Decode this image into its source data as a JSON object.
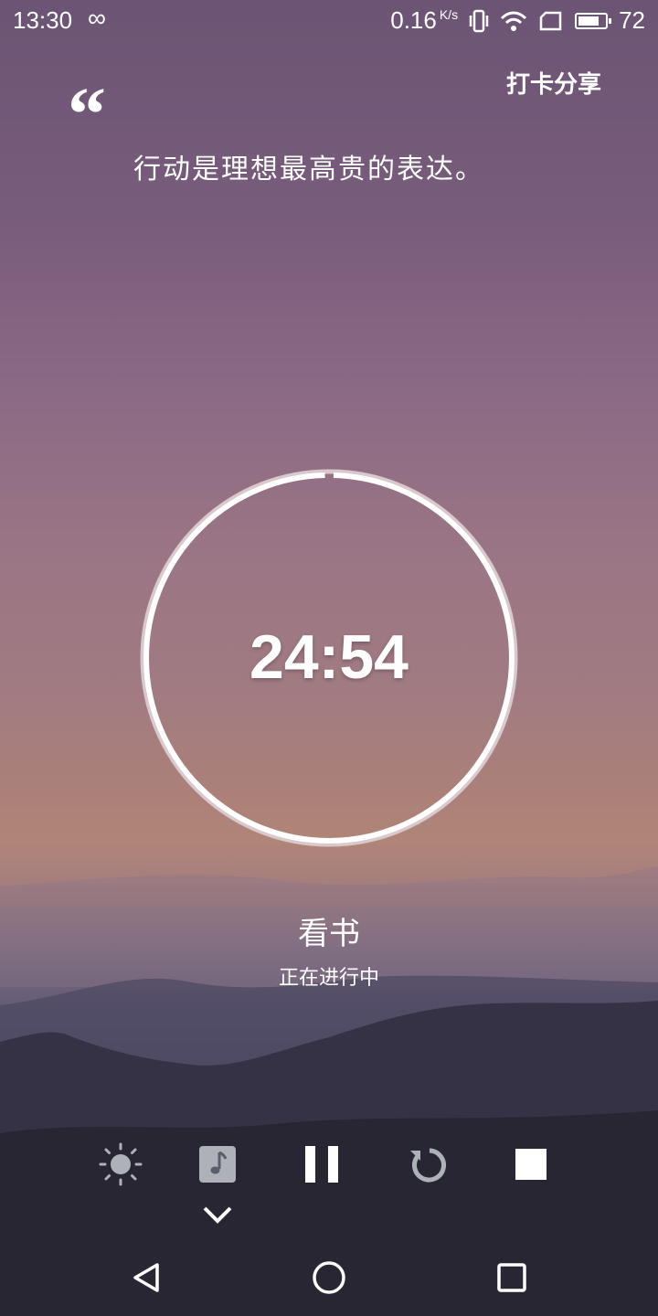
{
  "status_bar": {
    "time": "13:30",
    "infinity": "∞",
    "net_speed": "0.16",
    "net_unit": "K/s",
    "battery": "72"
  },
  "header": {
    "share_label": "打卡分享"
  },
  "quote": {
    "mark": "“",
    "text": "行动是理想最高贵的表达。"
  },
  "timer": {
    "remaining": "24:54",
    "progress": 0.004
  },
  "task": {
    "name": "看书",
    "status": "正在进行中"
  },
  "controls": {
    "icons": [
      "brightness-icon",
      "music-icon",
      "pause-icon",
      "restart-icon",
      "stop-icon"
    ]
  },
  "nav": {
    "icons": [
      "back-icon",
      "home-icon",
      "recents-icon"
    ]
  },
  "colors": {
    "ring": "#ffffff",
    "ring_track": "#d9c8cc",
    "inactive_icon": "#aeb2b8"
  }
}
